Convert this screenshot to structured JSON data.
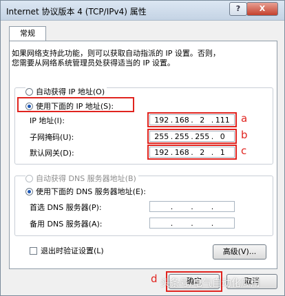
{
  "window": {
    "title": "Internet 协议版本 4 (TCP/IPv4) 属性",
    "help_label": "?",
    "close_label": "X"
  },
  "tabs": [
    "常规"
  ],
  "description": [
    "如果网络支持此功能，则可以获取自动指派的 IP 设置。否则，",
    "您需要从网络系统管理员处获得适当的 IP 设置。"
  ],
  "ip_section": {
    "auto_label": "自动获得 IP 地址(O)",
    "manual_label": "使用下面的 IP 地址(S):",
    "fields": [
      {
        "label": "IP 地址(I):",
        "value": [
          "192",
          "168",
          "2",
          "111"
        ],
        "marker": "a"
      },
      {
        "label": "子网掩码(U):",
        "value": [
          "255",
          "255",
          "255",
          "0"
        ],
        "marker": "b"
      },
      {
        "label": "默认网关(D):",
        "value": [
          "192",
          "168",
          "2",
          "1"
        ],
        "marker": "c"
      }
    ]
  },
  "dns_section": {
    "auto_label": "自动获得 DNS 服务器地址(B)",
    "manual_label": "使用下面的 DNS 服务器地址(E):",
    "fields": [
      {
        "label": "首选 DNS 服务器(P):",
        "value": [
          "",
          "",
          "",
          ""
        ]
      },
      {
        "label": "备用 DNS 服务器(A):",
        "value": [
          "",
          "",
          "",
          ""
        ]
      }
    ]
  },
  "validate_label": "退出时验证设置(L)",
  "advanced_button": "高级(V)...",
  "ok_button": "确定",
  "ok_marker": "d",
  "cancel_button": "取消",
  "watermark": "头条号/电气自动化应用",
  "colors": {
    "annotation_red": "#e0231e",
    "radio_selected": "#1b56b5"
  }
}
